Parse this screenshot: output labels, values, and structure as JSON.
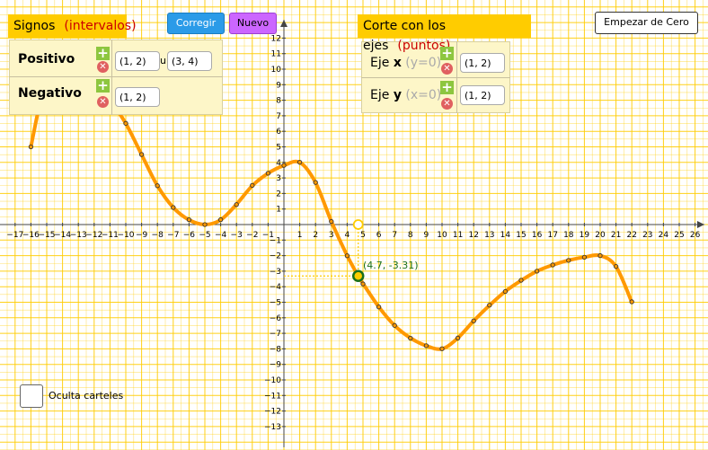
{
  "signos_panel": {
    "title": "Signos",
    "subtitle": "(intervalos)",
    "positivo_label": "Positivo",
    "negativo_label": "Negativo",
    "positivo_field1": "(1, 2)",
    "union_symbol": "u",
    "positivo_field2": "(3, 4)",
    "negativo_field": "(1, 2)"
  },
  "toolbar": {
    "corregir_label": "Corregir",
    "nuevo_label": "Nuevo",
    "empezar_label": "Empezar de Cero"
  },
  "corte_panel": {
    "title": "Corte con los ejes",
    "subtitle": "(puntos)",
    "eje_x_label": "Eje",
    "eje_x_axis": "x",
    "eje_x_cond": "(y=0)",
    "eje_x_field": "(1, 2)",
    "eje_y_label": "Eje",
    "eje_y_axis": "y",
    "eje_y_cond": "(x=0)",
    "eje_y_field": "(1, 2)"
  },
  "plus_symbol": "+",
  "cross_symbol": "✕",
  "checkbox_label": "Oculta carteles",
  "point_label": "(4.7, -3.31)",
  "chart_data": {
    "type": "line",
    "xlim": [
      -18,
      27
    ],
    "ylim": [
      -14,
      13
    ],
    "x_ticks": [
      -17,
      -16,
      -15,
      -14,
      -13,
      -12,
      -11,
      -10,
      -9,
      -8,
      -7,
      -6,
      -5,
      -4,
      -3,
      -2,
      -1,
      1,
      2,
      3,
      4,
      5,
      6,
      7,
      8,
      9,
      10,
      11,
      12,
      13,
      14,
      15,
      16,
      17,
      18,
      19,
      20,
      21,
      22,
      23,
      24,
      25,
      26
    ],
    "y_ticks": [
      12,
      11,
      10,
      9,
      8,
      7,
      6,
      5,
      4,
      3,
      2,
      1,
      -1,
      -2,
      -3,
      -4,
      -5,
      -6,
      -7,
      -8,
      -9,
      -10,
      -11,
      -12,
      -13
    ],
    "grid": true,
    "curve_color": "#ff9900",
    "point_color": "#1a6f1a",
    "curve": {
      "x": [
        -16,
        -15.3,
        -15,
        -14.5,
        -14,
        -13,
        -12,
        -11,
        -10,
        -9,
        -8,
        -7,
        -6,
        -5,
        -4,
        -3,
        -2,
        -1,
        0,
        1,
        2,
        3,
        4,
        4.7,
        5,
        6,
        7,
        8,
        9,
        10,
        11,
        12,
        13,
        14,
        15,
        16,
        17,
        18,
        19,
        20,
        21,
        22
      ],
      "y": [
        5,
        8.5,
        9.5,
        10,
        10,
        9.8,
        9.1,
        8,
        6.5,
        4.5,
        2.5,
        1.1,
        0.3,
        0,
        0.3,
        1.3,
        2.5,
        3.3,
        3.8,
        4,
        2.7,
        0.2,
        -2,
        -3.31,
        -3.8,
        -5.3,
        -6.5,
        -7.3,
        -7.8,
        -8,
        -7.3,
        -6.2,
        -5.2,
        -4.3,
        -3.6,
        -3,
        -2.6,
        -2.3,
        -2.1,
        -2,
        -2.7,
        -5
      ]
    },
    "markers_x": [
      -16,
      -15,
      -14,
      -13,
      -12,
      -11,
      -10,
      -9,
      -8,
      -7,
      -6,
      -5,
      -4,
      -3,
      -2,
      -1,
      0,
      1,
      2,
      3,
      4,
      5,
      6,
      7,
      8,
      9,
      10,
      11,
      12,
      13,
      14,
      15,
      16,
      17,
      18,
      19,
      20,
      21,
      22
    ],
    "point": {
      "x": 4.7,
      "y": -3.31
    }
  }
}
